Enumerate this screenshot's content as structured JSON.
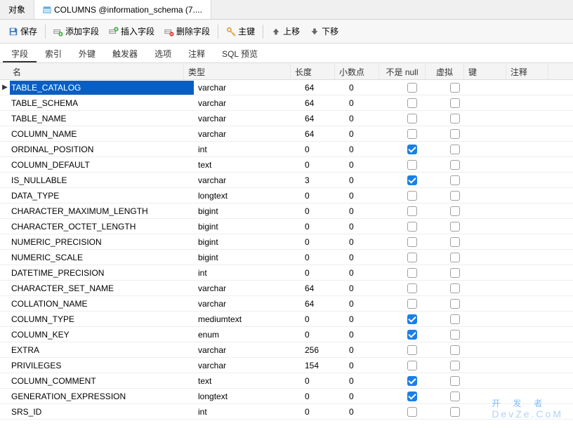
{
  "topTabs": {
    "object": "对象",
    "columns": "COLUMNS @information_schema (7...."
  },
  "toolbar": {
    "save": "保存",
    "addField": "添加字段",
    "insertField": "插入字段",
    "deleteField": "删除字段",
    "primaryKey": "主键",
    "moveUp": "上移",
    "moveDown": "下移"
  },
  "subtabs": {
    "fields": "字段",
    "indexes": "索引",
    "fkeys": "外键",
    "triggers": "触发器",
    "options": "选项",
    "comments": "注释",
    "sqlPreview": "SQL 预览"
  },
  "columns": {
    "name": "名",
    "type": "类型",
    "length": "长度",
    "decimals": "小数点",
    "notNull": "不是 null",
    "virtual": "虚拟",
    "key": "键",
    "comment": "注释"
  },
  "rows": [
    {
      "name": "TABLE_CATALOG",
      "type": "varchar",
      "len": "64",
      "dec": "0",
      "nn": false,
      "v": false,
      "sel": true
    },
    {
      "name": "TABLE_SCHEMA",
      "type": "varchar",
      "len": "64",
      "dec": "0",
      "nn": false,
      "v": false
    },
    {
      "name": "TABLE_NAME",
      "type": "varchar",
      "len": "64",
      "dec": "0",
      "nn": false,
      "v": false
    },
    {
      "name": "COLUMN_NAME",
      "type": "varchar",
      "len": "64",
      "dec": "0",
      "nn": false,
      "v": false
    },
    {
      "name": "ORDINAL_POSITION",
      "type": "int",
      "len": "0",
      "dec": "0",
      "nn": true,
      "v": false
    },
    {
      "name": "COLUMN_DEFAULT",
      "type": "text",
      "len": "0",
      "dec": "0",
      "nn": false,
      "v": false
    },
    {
      "name": "IS_NULLABLE",
      "type": "varchar",
      "len": "3",
      "dec": "0",
      "nn": true,
      "v": false
    },
    {
      "name": "DATA_TYPE",
      "type": "longtext",
      "len": "0",
      "dec": "0",
      "nn": false,
      "v": false
    },
    {
      "name": "CHARACTER_MAXIMUM_LENGTH",
      "type": "bigint",
      "len": "0",
      "dec": "0",
      "nn": false,
      "v": false
    },
    {
      "name": "CHARACTER_OCTET_LENGTH",
      "type": "bigint",
      "len": "0",
      "dec": "0",
      "nn": false,
      "v": false
    },
    {
      "name": "NUMERIC_PRECISION",
      "type": "bigint",
      "len": "0",
      "dec": "0",
      "nn": false,
      "v": false
    },
    {
      "name": "NUMERIC_SCALE",
      "type": "bigint",
      "len": "0",
      "dec": "0",
      "nn": false,
      "v": false
    },
    {
      "name": "DATETIME_PRECISION",
      "type": "int",
      "len": "0",
      "dec": "0",
      "nn": false,
      "v": false
    },
    {
      "name": "CHARACTER_SET_NAME",
      "type": "varchar",
      "len": "64",
      "dec": "0",
      "nn": false,
      "v": false
    },
    {
      "name": "COLLATION_NAME",
      "type": "varchar",
      "len": "64",
      "dec": "0",
      "nn": false,
      "v": false
    },
    {
      "name": "COLUMN_TYPE",
      "type": "mediumtext",
      "len": "0",
      "dec": "0",
      "nn": true,
      "v": false
    },
    {
      "name": "COLUMN_KEY",
      "type": "enum",
      "len": "0",
      "dec": "0",
      "nn": true,
      "v": false
    },
    {
      "name": "EXTRA",
      "type": "varchar",
      "len": "256",
      "dec": "0",
      "nn": false,
      "v": false
    },
    {
      "name": "PRIVILEGES",
      "type": "varchar",
      "len": "154",
      "dec": "0",
      "nn": false,
      "v": false
    },
    {
      "name": "COLUMN_COMMENT",
      "type": "text",
      "len": "0",
      "dec": "0",
      "nn": true,
      "v": false
    },
    {
      "name": "GENERATION_EXPRESSION",
      "type": "longtext",
      "len": "0",
      "dec": "0",
      "nn": true,
      "v": false
    },
    {
      "name": "SRS_ID",
      "type": "int",
      "len": "0",
      "dec": "0",
      "nn": false,
      "v": false
    }
  ],
  "watermark": {
    "main": "开发者",
    "sub": "DevZe.CoM"
  }
}
